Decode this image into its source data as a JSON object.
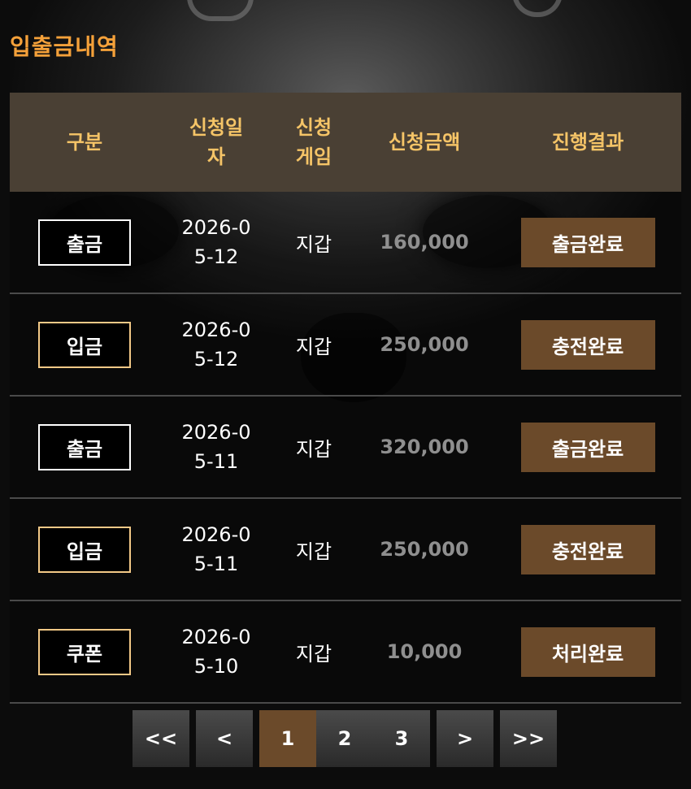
{
  "title": "입출금내역",
  "headers": {
    "type": "구분",
    "date": "신청일자",
    "game": "신청게임",
    "amount": "신청금액",
    "result": "진행결과"
  },
  "rows": [
    {
      "type": "출금",
      "type_style": "white",
      "date": "2026-05-12",
      "game": "지갑",
      "amount": "160,000",
      "result": "출금완료"
    },
    {
      "type": "입금",
      "type_style": "gold",
      "date": "2026-05-12",
      "game": "지갑",
      "amount": "250,000",
      "result": "충전완료"
    },
    {
      "type": "출금",
      "type_style": "white",
      "date": "2026-05-11",
      "game": "지갑",
      "amount": "320,000",
      "result": "출금완료"
    },
    {
      "type": "입금",
      "type_style": "gold",
      "date": "2026-05-11",
      "game": "지갑",
      "amount": "250,000",
      "result": "충전완료"
    },
    {
      "type": "쿠폰",
      "type_style": "gold",
      "date": "2026-05-10",
      "game": "지갑",
      "amount": "10,000",
      "result": "처리완료"
    }
  ],
  "pagination": {
    "first": "<<",
    "prev": "<",
    "pages": [
      "1",
      "2",
      "3"
    ],
    "current": "1",
    "next": ">",
    "last": ">>"
  },
  "colors": {
    "title": "#f5a13a",
    "header_bg": "#4a4034",
    "header_text": "#f5c467",
    "status_bg": "#6b4a2a",
    "gold_border": "#f3c987"
  }
}
